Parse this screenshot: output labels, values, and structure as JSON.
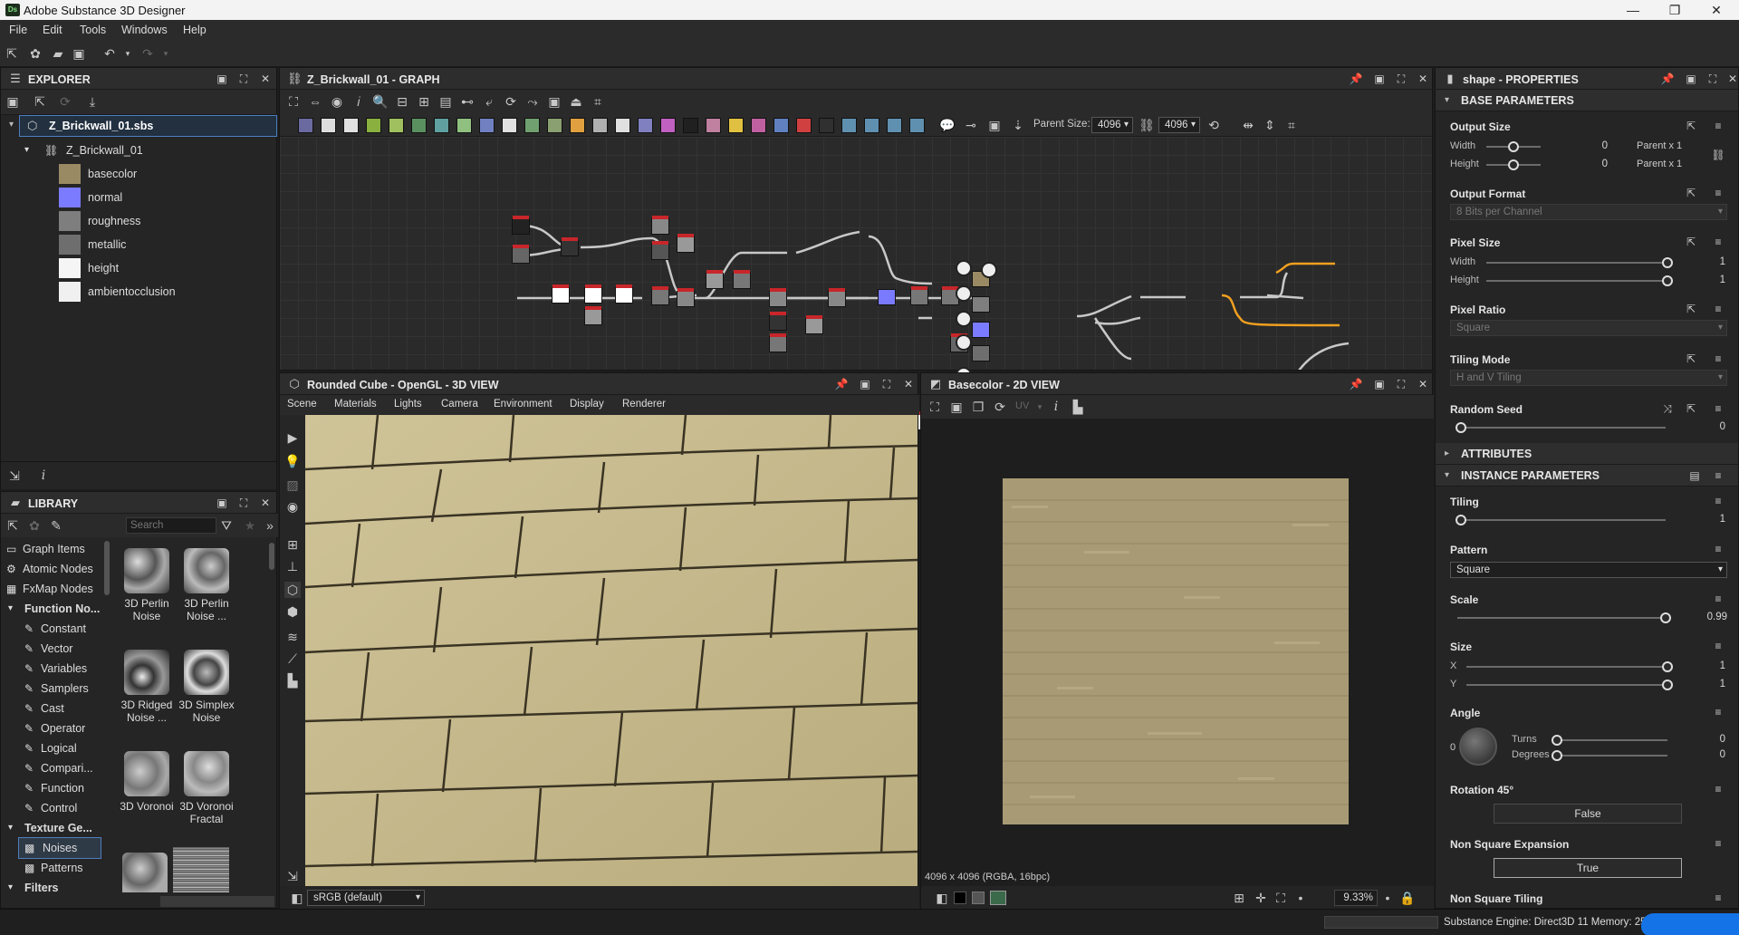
{
  "app": {
    "title": "Adobe Substance 3D Designer",
    "logo": "Ds"
  },
  "menu": [
    "File",
    "Edit",
    "Tools",
    "Windows",
    "Help"
  ],
  "explorer": {
    "title": "EXPLORER",
    "file": "Z_Brickwall_01.sbs",
    "graph": "Z_Brickwall_01",
    "outputs": [
      {
        "label": "basecolor",
        "color": "#9a8a64"
      },
      {
        "label": "normal",
        "color": "#7b7bff"
      },
      {
        "label": "roughness",
        "color": "#7e7e7e"
      },
      {
        "label": "metallic",
        "color": "#6e6e6e"
      },
      {
        "label": "height",
        "color": "#f5f5f5"
      },
      {
        "label": "ambientocclusion",
        "color": "#f0f0f0"
      }
    ]
  },
  "graph": {
    "title": "Z_Brickwall_01 - GRAPH",
    "parent_size_label": "Parent Size:",
    "parent_size": "4096",
    "size2": "4096"
  },
  "view3d": {
    "title": "Rounded Cube - OpenGL - 3D VIEW",
    "menus": [
      "Scene",
      "Materials",
      "Lights",
      "Camera",
      "Environment",
      "Display",
      "Renderer"
    ],
    "colorspace": "sRGB (default)"
  },
  "view2d": {
    "title": "Basecolor - 2D VIEW",
    "uv_label": "UV",
    "info": "4096 x 4096 (RGBA, 16bpc)",
    "zoom": "9.33%"
  },
  "library": {
    "title": "LIBRARY",
    "search_placeholder": "Search",
    "categories": [
      "Graph Items",
      "Atomic Nodes",
      "FxMap Nodes",
      "Function No...",
      "Constant",
      "Vector",
      "Variables",
      "Samplers",
      "Cast",
      "Operator",
      "Logical",
      "Compari...",
      "Function",
      "Control",
      "Texture Ge...",
      "Noises",
      "Patterns",
      "Filters"
    ],
    "items": [
      {
        "label": "3D Perlin Noise"
      },
      {
        "label": "3D Perlin Noise ..."
      },
      {
        "label": "3D Ridged Noise ..."
      },
      {
        "label": "3D Simplex Noise"
      },
      {
        "label": "3D Voronoi"
      },
      {
        "label": "3D Voronoi Fractal"
      }
    ]
  },
  "properties": {
    "title": "shape - PROPERTIES",
    "base_params": "BASE PARAMETERS",
    "output_size": {
      "label": "Output Size",
      "width_label": "Width",
      "height_label": "Height",
      "width": "0",
      "height": "0",
      "width_rel": "Parent x 1",
      "height_rel": "Parent x 1"
    },
    "output_format": {
      "label": "Output Format",
      "value": "8 Bits per Channel"
    },
    "pixel_size": {
      "label": "Pixel Size",
      "width_label": "Width",
      "height_label": "Height",
      "width": "1",
      "height": "1"
    },
    "pixel_ratio": {
      "label": "Pixel Ratio",
      "value": "Square"
    },
    "tiling_mode": {
      "label": "Tiling Mode",
      "value": "H and V Tiling"
    },
    "random_seed": {
      "label": "Random Seed",
      "value": "0"
    },
    "attributes": "ATTRIBUTES",
    "instance_params": "INSTANCE PARAMETERS",
    "tiling": {
      "label": "Tiling",
      "value": "1"
    },
    "pattern": {
      "label": "Pattern",
      "value": "Square"
    },
    "scale": {
      "label": "Scale",
      "value": "0.99"
    },
    "size": {
      "label": "Size",
      "x_label": "X",
      "y_label": "Y",
      "x": "1",
      "y": "1"
    },
    "angle": {
      "label": "Angle",
      "dial_value": "0",
      "turns_label": "Turns",
      "degrees_label": "Degrees",
      "turns": "0",
      "degrees": "0"
    },
    "rotation45": {
      "label": "Rotation 45°",
      "value": "False"
    },
    "non_square_expansion": {
      "label": "Non Square Expansion",
      "value": "True"
    },
    "non_square_tiling": {
      "label": "Non Square Tiling"
    }
  },
  "status": {
    "engine": "Substance Engine: Direct3D 11  Memory: 25"
  }
}
